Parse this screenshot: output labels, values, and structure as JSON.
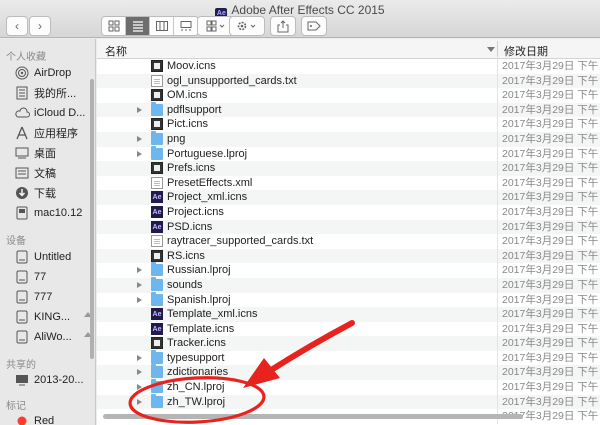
{
  "window": {
    "title": "Adobe After Effects CC 2015",
    "app_badge": "Ae"
  },
  "toolbar": {
    "back": "‹",
    "forward": "›",
    "view_modes": [
      "grid-icon",
      "list-icon",
      "columns-icon",
      "gallery-icon"
    ],
    "arrange": "arrange-icon",
    "action": "gear-icon",
    "share": "share-icon",
    "tags": "tag-icon"
  },
  "sidebar": {
    "favorites_header": "个人收藏",
    "favorites": [
      {
        "icon": "airdrop-icon",
        "label": "AirDrop"
      },
      {
        "icon": "all-files-icon",
        "label": "我的所..."
      },
      {
        "icon": "cloud-icon",
        "label": "iCloud D..."
      },
      {
        "icon": "applications-icon",
        "label": "应用程序"
      },
      {
        "icon": "desktop-icon",
        "label": "桌面"
      },
      {
        "icon": "documents-icon",
        "label": "文稿"
      },
      {
        "icon": "downloads-icon",
        "label": "下载"
      },
      {
        "icon": "home-icon",
        "label": "mac10.12"
      }
    ],
    "devices_header": "设备",
    "devices": [
      {
        "icon": "disk-icon",
        "label": "Untitled"
      },
      {
        "icon": "disk-icon",
        "label": "77"
      },
      {
        "icon": "disk-icon",
        "label": "777"
      },
      {
        "icon": "disk-icon",
        "label": "KING..."
      },
      {
        "icon": "disk-icon",
        "label": "AliWo..."
      }
    ],
    "shared_header": "共享的",
    "shared": [
      {
        "icon": "monitor-icon",
        "label": "2013-20..."
      }
    ],
    "tags_header": "标记",
    "tags": [
      {
        "color": "#ff3b30",
        "label": "Red"
      }
    ]
  },
  "list": {
    "col_name": "名称",
    "col_date": "修改日期",
    "rows": [
      {
        "name": "Moov.icns",
        "kind": "icns",
        "date": "2017年3月29日 下午"
      },
      {
        "name": "ogl_unsupported_cards.txt",
        "kind": "doc",
        "date": "2017年3月29日 下午"
      },
      {
        "name": "OM.icns",
        "kind": "icns",
        "date": "2017年3月29日 下午"
      },
      {
        "name": "pdflsupport",
        "kind": "folder",
        "date": "2017年3月29日 下午"
      },
      {
        "name": "Pict.icns",
        "kind": "icns",
        "date": "2017年3月29日 下午"
      },
      {
        "name": "png",
        "kind": "folder",
        "date": "2017年3月29日 下午"
      },
      {
        "name": "Portuguese.lproj",
        "kind": "folder",
        "date": "2017年3月29日 下午"
      },
      {
        "name": "Prefs.icns",
        "kind": "icns",
        "date": "2017年3月29日 下午"
      },
      {
        "name": "PresetEffects.xml",
        "kind": "doc",
        "date": "2017年3月29日 下午"
      },
      {
        "name": "Project_xml.icns",
        "kind": "ae",
        "date": "2017年3月29日 下午"
      },
      {
        "name": "Project.icns",
        "kind": "ae",
        "date": "2017年3月29日 下午"
      },
      {
        "name": "PSD.icns",
        "kind": "ae",
        "date": "2017年3月29日 下午"
      },
      {
        "name": "raytracer_supported_cards.txt",
        "kind": "doc",
        "date": "2017年3月29日 下午"
      },
      {
        "name": "RS.icns",
        "kind": "icns",
        "date": "2017年3月29日 下午"
      },
      {
        "name": "Russian.lproj",
        "kind": "folder",
        "date": "2017年3月29日 下午"
      },
      {
        "name": "sounds",
        "kind": "folder",
        "date": "2017年3月29日 下午"
      },
      {
        "name": "Spanish.lproj",
        "kind": "folder",
        "date": "2017年3月29日 下午"
      },
      {
        "name": "Template_xml.icns",
        "kind": "ae",
        "date": "2017年3月29日 下午"
      },
      {
        "name": "Template.icns",
        "kind": "ae",
        "date": "2017年3月29日 下午"
      },
      {
        "name": "Tracker.icns",
        "kind": "icns",
        "date": "2017年3月29日 下午"
      },
      {
        "name": "typesupport",
        "kind": "folder",
        "date": "2017年3月29日 下午"
      },
      {
        "name": "zdictionaries",
        "kind": "folder",
        "date": "2017年3月29日 下午"
      },
      {
        "name": "zh_CN.lproj",
        "kind": "folder",
        "date": "2017年3月29日 下午"
      },
      {
        "name": "zh_TW.lproj",
        "kind": "folder",
        "date": "2017年3月29日 下午"
      },
      {
        "name": "",
        "kind": "none",
        "date": "2017年3月29日 下午"
      }
    ]
  },
  "annotation": {
    "color": "#e8231d"
  }
}
